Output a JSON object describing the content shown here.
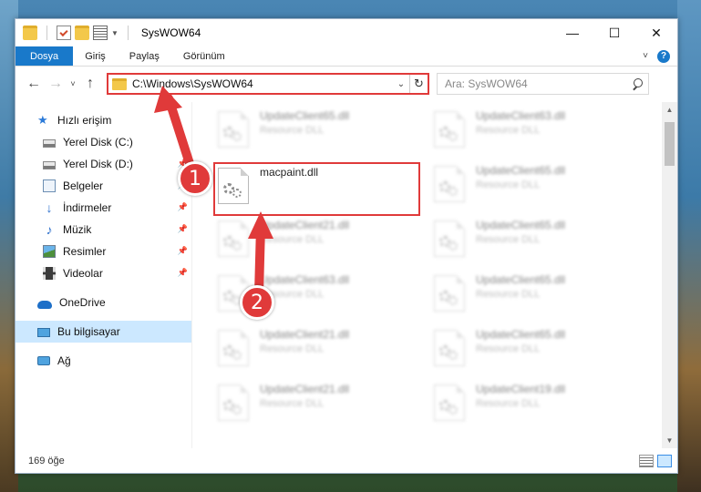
{
  "window": {
    "title": "SysWOW64"
  },
  "window_controls": {
    "minimize": "—",
    "maximize": "☐",
    "close": "✕"
  },
  "ribbon": {
    "tabs": [
      "Dosya",
      "Giriş",
      "Paylaş",
      "Görünüm"
    ]
  },
  "nav": {
    "back": "←",
    "forward": "→",
    "recent": "˅",
    "up": "↑",
    "address": "C:\\Windows\\SysWOW64",
    "search_placeholder": "Ara: SysWOW64"
  },
  "sidebar": {
    "items": [
      {
        "label": "Hızlı erişim",
        "icon": "star-icon"
      },
      {
        "label": "Yerel Disk (C:)",
        "icon": "drive-icon"
      },
      {
        "label": "Yerel Disk (D:)",
        "icon": "drive-icon",
        "pinned": true
      },
      {
        "label": "Belgeler",
        "icon": "documents-icon",
        "pinned": true
      },
      {
        "label": "İndirmeler",
        "icon": "downloads-icon",
        "pinned": true
      },
      {
        "label": "Müzik",
        "icon": "music-icon",
        "pinned": true
      },
      {
        "label": "Resimler",
        "icon": "pictures-icon",
        "pinned": true
      },
      {
        "label": "Videolar",
        "icon": "videos-icon",
        "pinned": true
      },
      {
        "label": "OneDrive",
        "icon": "cloud-icon"
      },
      {
        "label": "Bu bilgisayar",
        "icon": "computer-icon",
        "selected": true
      },
      {
        "label": "Ağ",
        "icon": "network-icon"
      }
    ]
  },
  "files": {
    "highlighted": {
      "name": "macpaint.dll"
    },
    "ghost_items": [
      {
        "name": "UpdateClient65.dll",
        "type": "Resource DLL"
      },
      {
        "name": "UpdateClient63.dll",
        "type": "Resource DLL"
      },
      {
        "name": "UpdateClient65.dll",
        "type": "Resource DLL"
      },
      {
        "name": "UpdateClient21.dll",
        "type": "Resource DLL"
      },
      {
        "name": "UpdateClient65.dll",
        "type": "Resource DLL"
      },
      {
        "name": "UpdateClient63.dll",
        "type": "Resource DLL"
      },
      {
        "name": "UpdateClient65.dll",
        "type": "Resource DLL"
      },
      {
        "name": "UpdateClient21.dll",
        "type": "Resource DLL"
      },
      {
        "name": "UpdateClient65.dll",
        "type": "Resource DLL"
      },
      {
        "name": "UpdateClient21.dll",
        "type": "Resource DLL"
      },
      {
        "name": "UpdateClient19.dll",
        "type": "Resource DLL"
      }
    ]
  },
  "status": {
    "count": "169 öğe"
  },
  "annotations": {
    "step1": "1",
    "step2": "2",
    "color": "#e03a3a"
  }
}
